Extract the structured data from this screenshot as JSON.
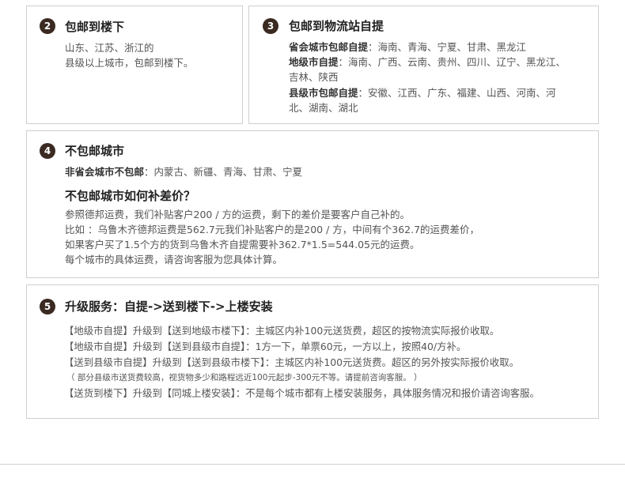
{
  "box2": {
    "num": "2",
    "title": "包邮到楼下",
    "lines": [
      "山东、江苏、浙江的",
      "县级以上城市，包邮到楼下。"
    ]
  },
  "box3": {
    "num": "3",
    "title": "包邮到物流站自提",
    "row1_label": "省会城市包邮自提",
    "row1_text": "：海南、青海、宁夏、甘肃、黑龙江",
    "row2_label": "地级市自提",
    "row2_text": "：海南、广西、云南、贵州、四川、辽宁、黑龙江、",
    "row2_cont": "吉林、陕西",
    "row3_label": "县级市包邮自提",
    "row3_text": "：安徽、江西、广东、福建、山西、河南、河",
    "row3_cont": "北、湖南、湖北"
  },
  "box4": {
    "num": "4",
    "title": "不包邮城市",
    "row_label": "非省会城市不包邮",
    "row_text": "：内蒙古、新疆、青海、甘肃、宁夏",
    "subtitle": "不包邮城市如何补差价？",
    "lines": [
      "参照德邦运费，我们补贴客户200 / 方的运费，剩下的差价是要客户自己补的。",
      "比如 ：乌鲁木齐德邦运费是562.7元我们补贴客户的是200 / 方，中间有个362.7的运费差价，",
      "如果客户买了1.5个方的货到乌鲁木齐自提需要补362.7*1.5=544.05元的运费。",
      "每个城市的具体运费，请咨询客服为您具体计算。"
    ]
  },
  "box5": {
    "num": "5",
    "title": "升级服务：自提->送到楼下->上楼安装",
    "lines": [
      "【地级市自提】升级到【送到地级市楼下】：主城区内补100元送货费，超区的按物流实际报价收取。",
      "【地级市自提】升级到【送到县级市自提】：1方一下，单票60元，一方以上，按照40/方补。",
      "【送到县级市自提】升级到【送到县级市楼下】：主城区内补100元送货费。超区的另外按实际报价收取。"
    ],
    "note": "（ 部分县级市送货费较高，视货物多少和路程远近100元起步-300元不等。请提前咨询客服。 ）",
    "last_line": "【送货到楼下】升级到【同城上楼安装】：不是每个城市都有上楼安装服务，具体服务情况和报价请咨询客服。"
  },
  "colors": {
    "badge": "#3a2a22",
    "border": "#cfcfcf",
    "text": "#555555",
    "heading": "#222222"
  }
}
